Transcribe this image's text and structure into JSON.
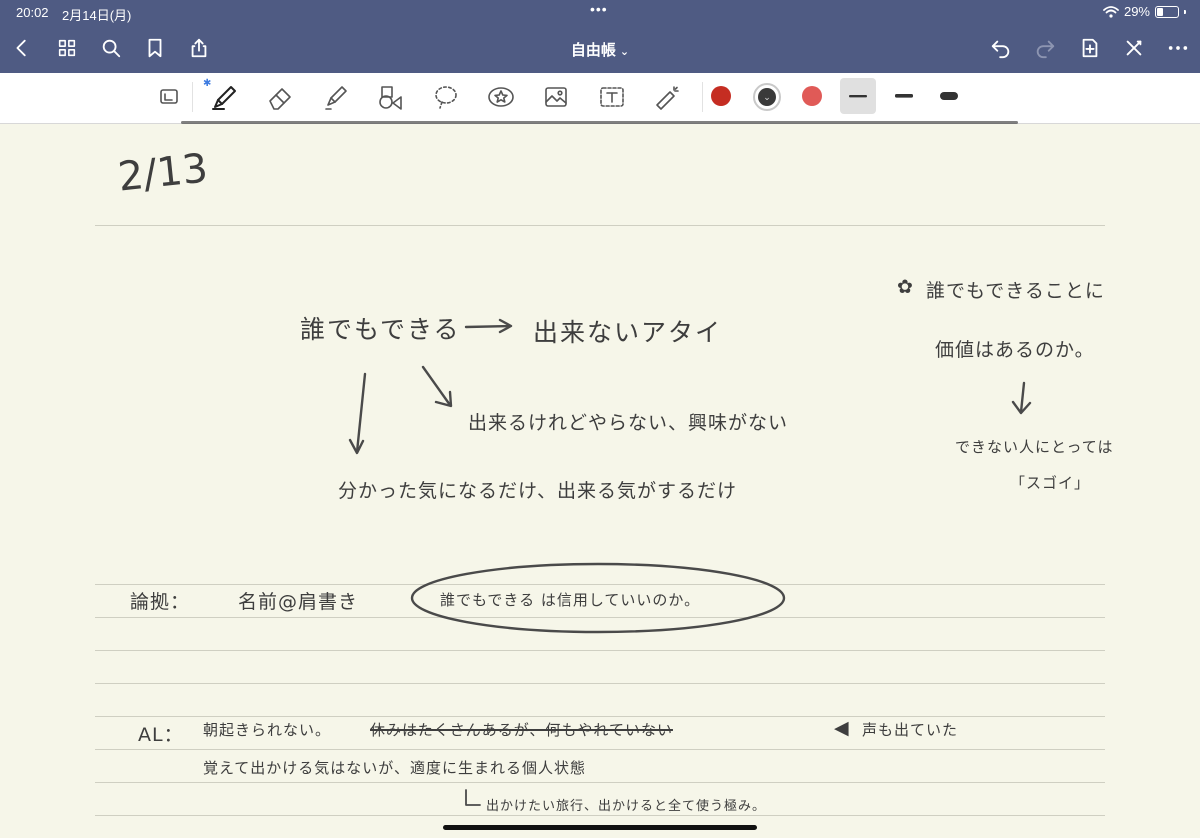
{
  "status": {
    "time": "20:02",
    "date": "2月14日(月)",
    "battery": "29%",
    "battery_fraction": 0.29
  },
  "nav": {
    "title": "自由帳",
    "title_caret": "⌄"
  },
  "toolbar": {
    "colors": [
      "#c52d22",
      "#3a3a3a",
      "#e05a57"
    ],
    "selected_color_index": 1,
    "sizes": [
      "thin",
      "medium",
      "thick"
    ],
    "selected_size_index": 0
  },
  "note": {
    "date": "2/13",
    "top_left": "誰でもできる",
    "arrow_target": "出来ないアタイ",
    "branch_right": "出来るけれどやらない、興味がない",
    "branch_down": "分かった気になるだけ、出来る気がするだけ",
    "side_heading_1": "誰でもできることに",
    "side_heading_2": "価値はあるのか。",
    "side_sub_1": "できない人にとっては",
    "side_sub_2": "「スゴイ」",
    "evidence_label": "論拠：",
    "evidence_source": "名前@肩書き",
    "evidence_circled": "誰でもできる は信用していいのか。",
    "al_label": "AL：",
    "al_line1_a": "朝起きられない。",
    "al_line1_struck": "休みはたくさんあるが、何もやれていない",
    "al_line1_b": "声も出ていた",
    "al_line2": "覚えて出かける気はないが、適度に生まれる個人状態",
    "al_line3": "出かけたい旅行、出かけると全て使う極み。"
  }
}
